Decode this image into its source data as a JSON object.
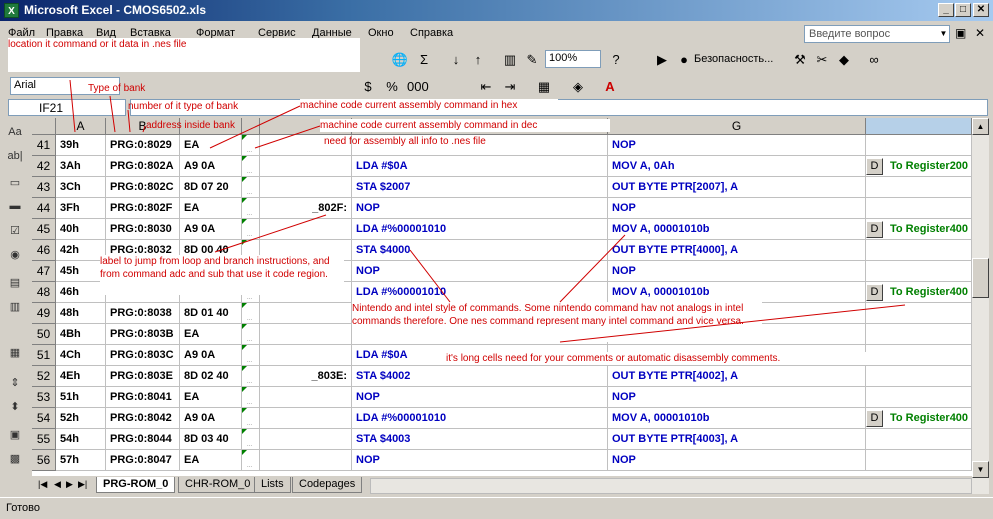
{
  "window": {
    "title": "Microsoft Excel - CMOS6502.xls"
  },
  "menu": [
    "Файл",
    "Правка",
    "Вид",
    "Вставка",
    "Формат",
    "Сервис",
    "Данные",
    "Окно",
    "Справка"
  ],
  "ask_placeholder": "Введите вопрос",
  "toolbar": {
    "zoom": "100%",
    "security": "Безопасность...",
    "font": "Arial"
  },
  "namebox": "IF21",
  "columns": {
    "a": "A",
    "b": "B",
    "g": "G"
  },
  "rows": [
    {
      "n": "41",
      "a": "39h",
      "b": "PRG:0:8029",
      "c": "EA",
      "d": "",
      "e": "",
      "f": "",
      "g": "NOP",
      "act": ""
    },
    {
      "n": "42",
      "a": "3Ah",
      "b": "PRG:0:802A",
      "c": "A9 0A",
      "d": "",
      "e": "LDA #$0A",
      "f": "",
      "g": "MOV A, 0Ah",
      "act": "To Register200"
    },
    {
      "n": "43",
      "a": "3Ch",
      "b": "PRG:0:802C",
      "c": "8D 07 20",
      "d": "",
      "e": "STA $2007",
      "f": "",
      "g": "OUT BYTE PTR[2007], A",
      "act": ""
    },
    {
      "n": "44",
      "a": "3Fh",
      "b": "PRG:0:802F",
      "c": "EA",
      "d": "_802F:",
      "e": "NOP",
      "f": "",
      "g": "NOP",
      "act": ""
    },
    {
      "n": "45",
      "a": "40h",
      "b": "PRG:0:8030",
      "c": "A9 0A",
      "d": "",
      "e": "LDA #%00001010",
      "f": "",
      "g": "MOV A, 00001010b",
      "act": "To Register400"
    },
    {
      "n": "46",
      "a": "42h",
      "b": "PRG:0:8032",
      "c": "8D 00 40",
      "d": "",
      "e": "STA $4000",
      "f": "",
      "g": "OUT BYTE PTR[4000], A",
      "act": ""
    },
    {
      "n": "47",
      "a": "45h",
      "b": "",
      "c": "",
      "d": "",
      "e": "NOP",
      "f": "",
      "g": "NOP",
      "act": ""
    },
    {
      "n": "48",
      "a": "46h",
      "b": "",
      "c": "",
      "d": "",
      "e": "LDA #%00001010",
      "f": "",
      "g": "MOV A, 00001010b",
      "act": "To Register400"
    },
    {
      "n": "49",
      "a": "48h",
      "b": "PRG:0:8038",
      "c": "8D 01 40",
      "d": "",
      "e": "",
      "f": "",
      "g": "",
      "act": ""
    },
    {
      "n": "50",
      "a": "4Bh",
      "b": "PRG:0:803B",
      "c": "EA",
      "d": "",
      "e": "",
      "f": "",
      "g": "",
      "act": ""
    },
    {
      "n": "51",
      "a": "4Ch",
      "b": "PRG:0:803C",
      "c": "A9 0A",
      "d": "",
      "e": "LDA #$0A",
      "f": "",
      "g": "",
      "act": ""
    },
    {
      "n": "52",
      "a": "4Eh",
      "b": "PRG:0:803E",
      "c": "8D 02 40",
      "d": "_803E:",
      "e": "STA $4002",
      "f": "",
      "g": "OUT BYTE PTR[4002], A",
      "act": ""
    },
    {
      "n": "53",
      "a": "51h",
      "b": "PRG:0:8041",
      "c": "EA",
      "d": "",
      "e": "NOP",
      "f": "",
      "g": "NOP",
      "act": ""
    },
    {
      "n": "54",
      "a": "52h",
      "b": "PRG:0:8042",
      "c": "A9 0A",
      "d": "",
      "e": "LDA #%00001010",
      "f": "",
      "g": "MOV A, 00001010b",
      "act": "To Register400"
    },
    {
      "n": "55",
      "a": "54h",
      "b": "PRG:0:8044",
      "c": "8D 03 40",
      "d": "",
      "e": "STA $4003",
      "f": "",
      "g": "OUT BYTE PTR[4003], A",
      "act": ""
    },
    {
      "n": "56",
      "a": "57h",
      "b": "PRG:0:8047",
      "c": "EA",
      "d": "",
      "e": "NOP",
      "f": "",
      "g": "NOP",
      "act": ""
    }
  ],
  "sheets": [
    "PRG-ROM_0",
    "CHR-ROM_0",
    "Lists",
    "Codepages"
  ],
  "status": "Готово",
  "annotations": {
    "location": "location it command or it data in .nes file",
    "type": "Type of bank",
    "number": "number of it type of bank",
    "address": "address inside bank",
    "hex": "machine code current assembly command in hex",
    "dec": "machine code current assembly command in dec",
    "need": "need for assembly all info to .nes file",
    "label": "label to jump from loop and branch instructions, and from command adc and sub that use it code region.",
    "style": "Nintendo and intel style of commands. Some nintendo command hav not analogs in intel commands therefore. One nes command represent many intel command and vice versa.",
    "long": "it's long cells need for your comments or automatic disassembly comments."
  }
}
